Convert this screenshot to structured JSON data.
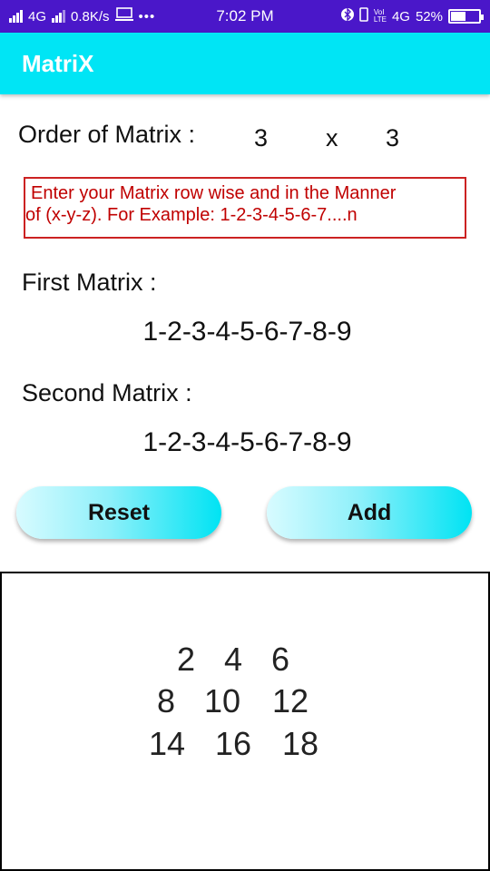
{
  "status_bar": {
    "network_left": "4G",
    "speed": "0.8K/s",
    "time": "7:02 PM",
    "network_right": "4G",
    "battery": "52%",
    "battery_level": 0.52
  },
  "app": {
    "title": "MatriX"
  },
  "order": {
    "label": "Order of Matrix :",
    "rows": "3",
    "separator": "x",
    "cols": "3"
  },
  "instruction": {
    "line1": "Enter your Matrix  row wise and in the Manner",
    "line2": "of (x-y-z).  For Example: 1-2-3-4-5-6-7....n"
  },
  "first_matrix": {
    "label": "First Matrix :",
    "value": "1-2-3-4-5-6-7-8-9"
  },
  "second_matrix": {
    "label": "Second Matrix :",
    "value": "1-2-3-4-5-6-7-8-9"
  },
  "buttons": {
    "reset": "Reset",
    "add": "Add"
  },
  "result": {
    "rows": [
      [
        "2",
        "4",
        "6"
      ],
      [
        "8",
        "10",
        "12"
      ],
      [
        "14",
        "16",
        "18"
      ]
    ]
  },
  "colors": {
    "status_bar": "#4a17c9",
    "app_bar": "#00e5f5",
    "instruction_text": "#c00000",
    "instruction_border": "#cc2222"
  }
}
